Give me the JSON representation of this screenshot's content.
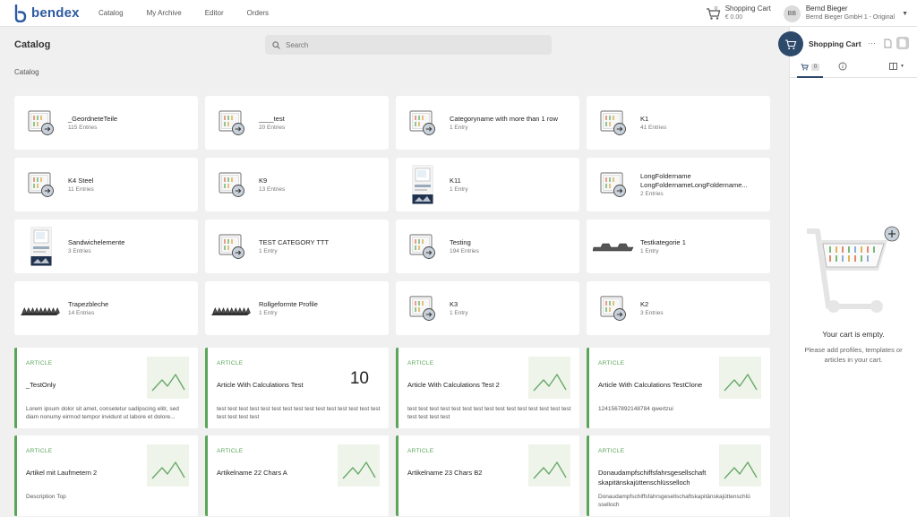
{
  "app": {
    "name": "bendex"
  },
  "nav": [
    "Catalog",
    "My Archive",
    "Editor",
    "Orders"
  ],
  "topbar": {
    "cart_label": "Shopping Cart",
    "cart_count": "0",
    "cart_total": "€ 0.00",
    "user_initials": "BB",
    "user_name": "Bernd Bieger",
    "user_company": "Bernd Bieger GmbH 1 - Original"
  },
  "page": {
    "title": "Catalog",
    "search_placeholder": "Search",
    "breadcrumb": "Catalog"
  },
  "categories": [
    {
      "name": "_GeordneteTeile",
      "count": "115 Entries",
      "icon": "catalog-folder-icon"
    },
    {
      "name": "____test",
      "count": "20 Entries",
      "icon": "catalog-folder-icon"
    },
    {
      "name": "Categoryname with more than 1 row",
      "count": "1 Entry",
      "icon": "catalog-folder-icon"
    },
    {
      "name": "K1",
      "count": "41 Entries",
      "icon": "catalog-folder-icon"
    },
    {
      "name": "K4 Steel",
      "count": "11 Entries",
      "icon": "catalog-folder-icon"
    },
    {
      "name": "K9",
      "count": "13 Entries",
      "icon": "catalog-folder-icon"
    },
    {
      "name": "K11",
      "count": "1 Entry",
      "icon": "brochure-image"
    },
    {
      "name": "LongFoldername LongFoldernameLongFoldername...",
      "count": "2 Entries",
      "icon": "catalog-folder-icon"
    },
    {
      "name": "Sandwichelemente",
      "count": "3 Entries",
      "icon": "brochure-image"
    },
    {
      "name": "TEST CATEGORY TTT",
      "count": "1 Entry",
      "icon": "catalog-folder-icon"
    },
    {
      "name": "Testing",
      "count": "194 Entries",
      "icon": "catalog-folder-icon"
    },
    {
      "name": "Testkategorie 1",
      "count": "1 Entry",
      "icon": "profile-sheet-image"
    },
    {
      "name": "Trapezbleche",
      "count": "14 Entries",
      "icon": "corrugated-sheet-image"
    },
    {
      "name": "Rollgeformte Profile",
      "count": "1 Entry",
      "icon": "corrugated-sheet-image"
    },
    {
      "name": "K3",
      "count": "1 Entry",
      "icon": "catalog-folder-icon"
    },
    {
      "name": "K2",
      "count": "3 Entries",
      "icon": "catalog-folder-icon"
    }
  ],
  "articles": [
    {
      "type": "ARTICLE",
      "title": "_TestOnly",
      "desc": "Lorem ipsum dolor sit amet, consetetur sadipscing elitr, sed diam nonumy eirmod tempor invidunt ut labore et dolore...",
      "number": ""
    },
    {
      "type": "ARTICLE",
      "title": "Article With Calculations Test",
      "desc": "test test test test test test test test test test test test test test test test test test test",
      "number": "10"
    },
    {
      "type": "ARTICLE",
      "title": "Article With Calculations Test 2",
      "desc": "test test test test test test test test test test test test test test test test test test test",
      "number": ""
    },
    {
      "type": "ARTICLE",
      "title": "Article With Calculations TestClone",
      "desc": "1241567892148784 qwertzui",
      "number": ""
    },
    {
      "type": "ARTICLE",
      "title": "Artikel mit Laufmetern 2",
      "desc": "Description Top",
      "number": ""
    },
    {
      "type": "ARTICLE",
      "title": "Artikelname 22 Chars A",
      "desc": "",
      "number": ""
    },
    {
      "type": "ARTICLE",
      "title": "Artikelname 23 Chars B2",
      "desc": "",
      "number": ""
    },
    {
      "type": "ARTICLE",
      "title": "Donaudampfschiffsfahrsgesellschaft skapitänskajüttenschlüsselloch",
      "desc": "Donaudampfschiffsfahrsgesellschaftskapitänskajüttenschlü sselloch",
      "number": ""
    }
  ],
  "panel": {
    "title": "Shopping Cart",
    "tab_count": "0",
    "empty_title": "Your cart is empty.",
    "empty_text": "Please add profiles, templates or articles in your cart."
  },
  "colors": {
    "brand": "#2c5aa0",
    "accent": "#5aa55a",
    "panel_dark": "#2e4a6b"
  }
}
